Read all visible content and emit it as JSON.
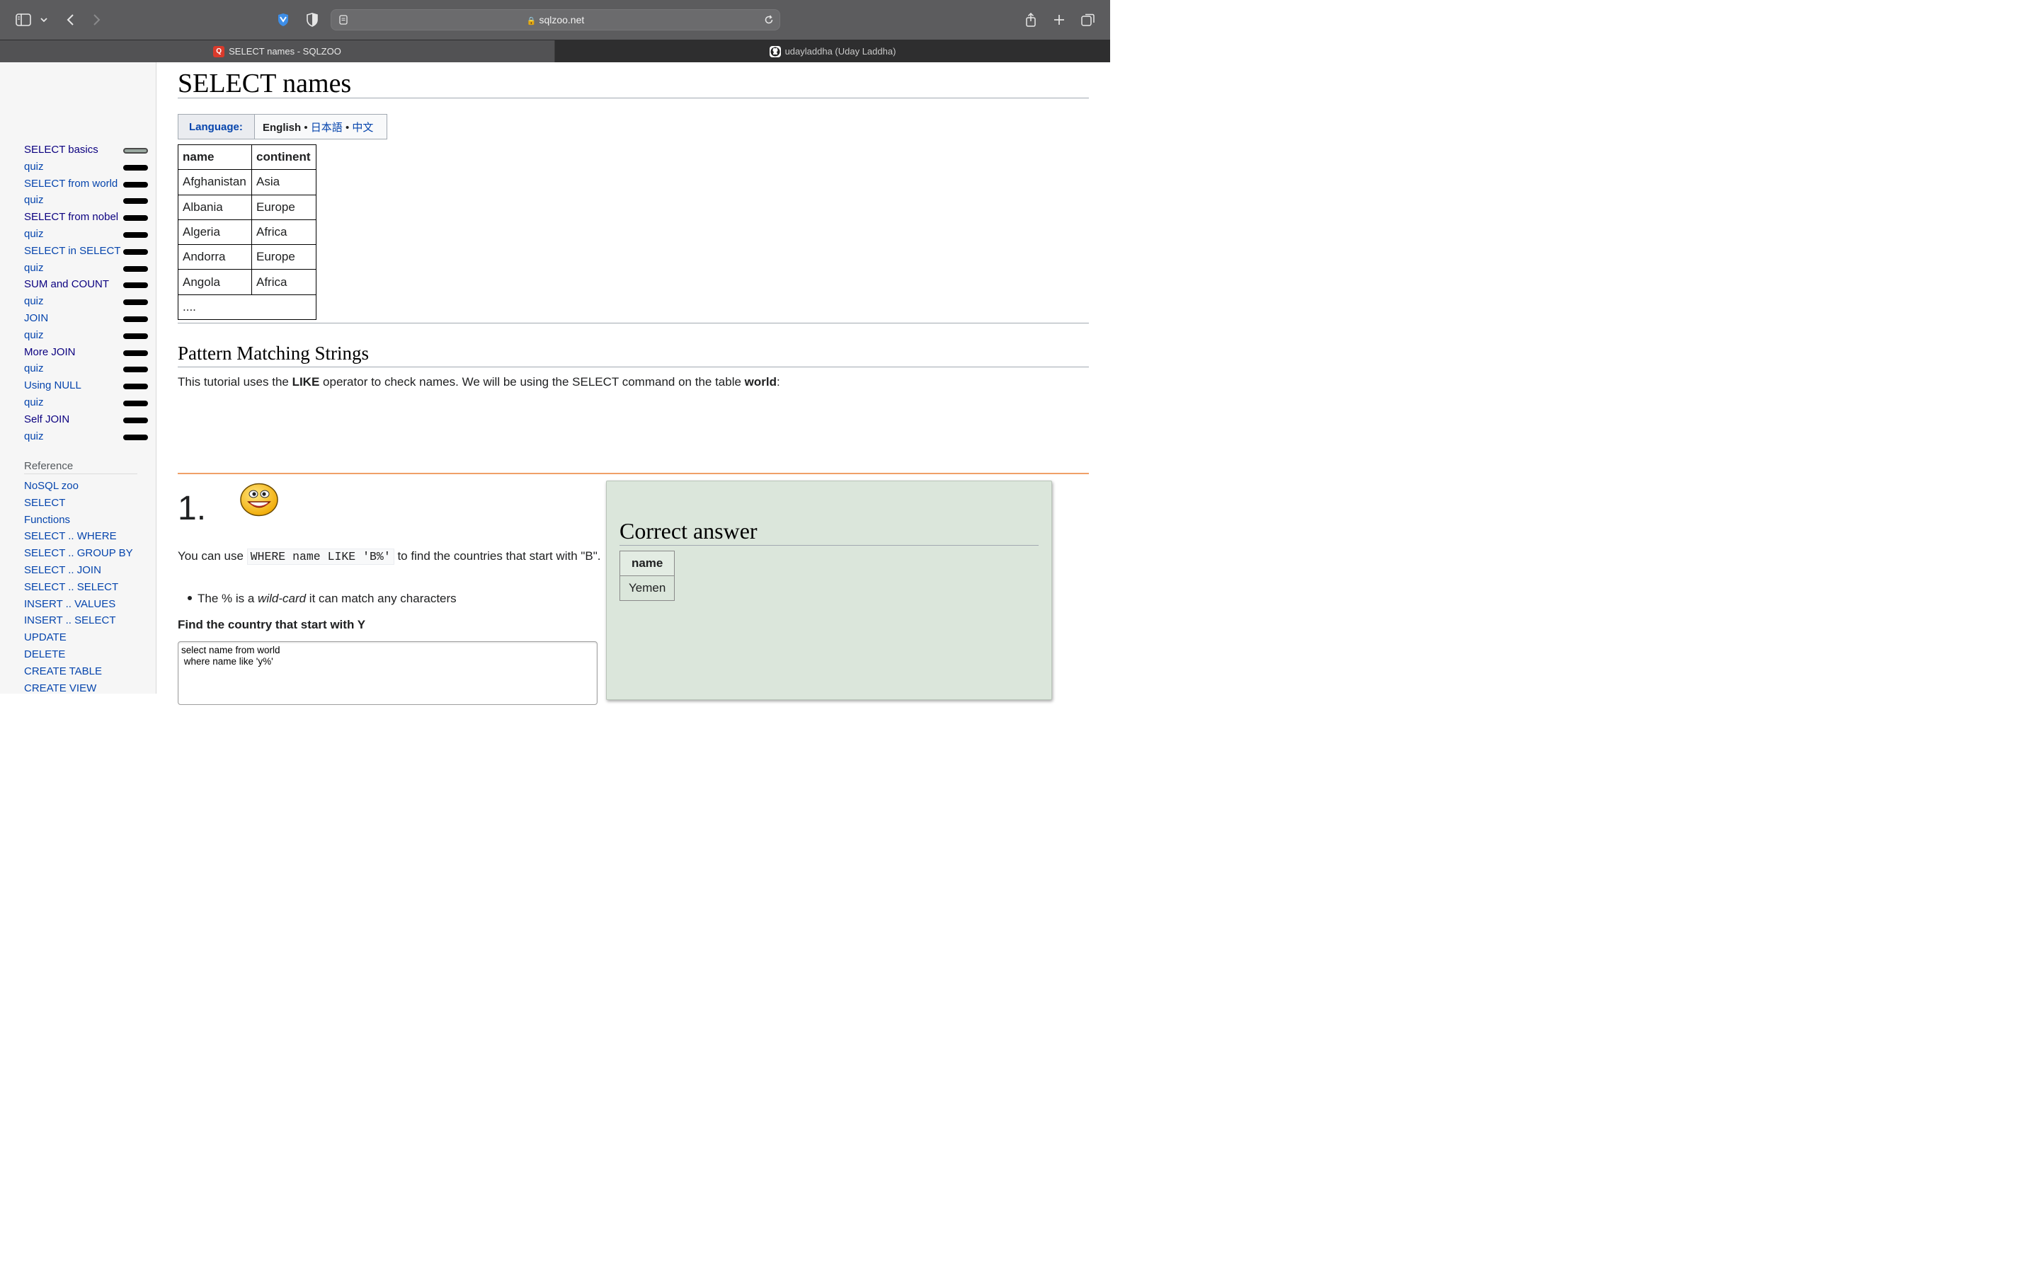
{
  "browser": {
    "url": "sqlzoo.net",
    "tabs": [
      {
        "title": "SELECT names - SQLZOO",
        "favicon": "sqlzoo-favicon"
      },
      {
        "title": "udayladdha (Uday Laddha)",
        "favicon": "github-icon"
      }
    ]
  },
  "sidebar": {
    "tutorials": [
      {
        "label": "SELECT basics",
        "status": "done"
      },
      {
        "label": "quiz",
        "status": "todo"
      },
      {
        "label": "SELECT from world",
        "status": "todo"
      },
      {
        "label": "quiz",
        "status": "todo"
      },
      {
        "label": "SELECT from nobel",
        "status": "todo"
      },
      {
        "label": "quiz",
        "status": "todo"
      },
      {
        "label": "SELECT in SELECT",
        "status": "todo"
      },
      {
        "label": "quiz",
        "status": "todo"
      },
      {
        "label": "SUM and COUNT",
        "status": "todo"
      },
      {
        "label": "quiz",
        "status": "todo"
      },
      {
        "label": "JOIN",
        "status": "todo"
      },
      {
        "label": "quiz",
        "status": "todo"
      },
      {
        "label": "More JOIN",
        "status": "todo"
      },
      {
        "label": "quiz",
        "status": "todo"
      },
      {
        "label": "Using NULL",
        "status": "todo"
      },
      {
        "label": "quiz",
        "status": "todo"
      },
      {
        "label": "Self JOIN",
        "status": "todo"
      },
      {
        "label": "quiz",
        "status": "todo"
      }
    ],
    "reference_heading": "Reference",
    "reference": [
      "NoSQL zoo",
      "SELECT",
      "Functions",
      "SELECT .. WHERE",
      "SELECT .. GROUP BY",
      "SELECT .. JOIN",
      "SELECT .. SELECT",
      "INSERT .. VALUES",
      "INSERT .. SELECT",
      "UPDATE",
      "DELETE",
      "CREATE TABLE",
      "CREATE VIEW"
    ]
  },
  "page": {
    "title": "SELECT names",
    "language": {
      "label": "Language:",
      "current": "English",
      "sep1": " • ",
      "ja": "日本語",
      "sep2": " • ",
      "zh": "中文"
    },
    "world_table": {
      "headers": [
        "name",
        "continent"
      ],
      "rows": [
        [
          "Afghanistan",
          "Asia"
        ],
        [
          "Albania",
          "Europe"
        ],
        [
          "Algeria",
          "Africa"
        ],
        [
          "Andorra",
          "Europe"
        ],
        [
          "Angola",
          "Africa"
        ]
      ],
      "ellipsis": "...."
    },
    "section_title": "Pattern Matching Strings",
    "intro": {
      "p1": "This tutorial uses the ",
      "like": "LIKE",
      "p2": " operator to check names. We will be using the SELECT command on the table ",
      "world": "world",
      "p3": ":"
    },
    "question": {
      "number": "1.",
      "text_before": "You can use ",
      "code": "WHERE name LIKE 'B%'",
      "text_after": " to find the countries that start with \"B\".",
      "bullet_before": "The % is a ",
      "bullet_em": "wild-card",
      "bullet_after": " it can match any characters",
      "task": "Find the country that start with Y",
      "sql": "select name from world\n where name like 'y%'"
    },
    "answer": {
      "title": "Correct answer",
      "headers": [
        "name"
      ],
      "rows": [
        [
          "Yemen"
        ]
      ]
    }
  }
}
